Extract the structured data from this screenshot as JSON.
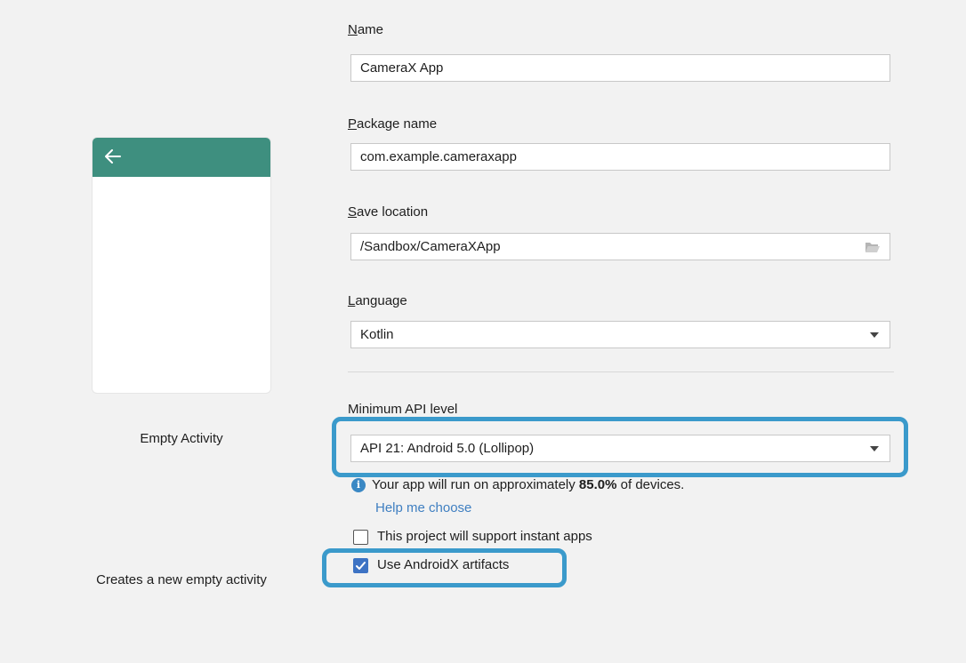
{
  "preview": {
    "back_icon": "arrow-left-icon",
    "activity_name": "Empty Activity",
    "activity_description": "Creates a new empty activity",
    "toolbar_color": "#3e8f7f"
  },
  "form": {
    "name": {
      "label_key": "N",
      "label_rest": "ame",
      "value": "CameraX App"
    },
    "package": {
      "label_key": "P",
      "label_rest": "ackage name",
      "value": "com.example.cameraxapp"
    },
    "save_location": {
      "label_key": "S",
      "label_rest": "ave location",
      "value": "/Sandbox/CameraXApp",
      "icon": "folder-icon"
    },
    "language": {
      "label_key": "L",
      "label_rest": "anguage",
      "value": "Kotlin"
    },
    "min_api": {
      "label": "Minimum API level",
      "value": "API 21: Android 5.0 (Lollipop)"
    },
    "info": {
      "icon": "info-icon",
      "prefix": "Your app will run on approximately ",
      "percent": "85.0%",
      "suffix": " of devices."
    },
    "help_link": "Help me choose",
    "instant_apps": {
      "label": "This project will support instant apps",
      "checked": false
    },
    "androidx": {
      "label": "Use AndroidX artifacts",
      "checked": true
    }
  },
  "colors": {
    "highlight": "#3b9acb",
    "link": "#3f7fc1",
    "checkbox_checked": "#3d73c4"
  }
}
